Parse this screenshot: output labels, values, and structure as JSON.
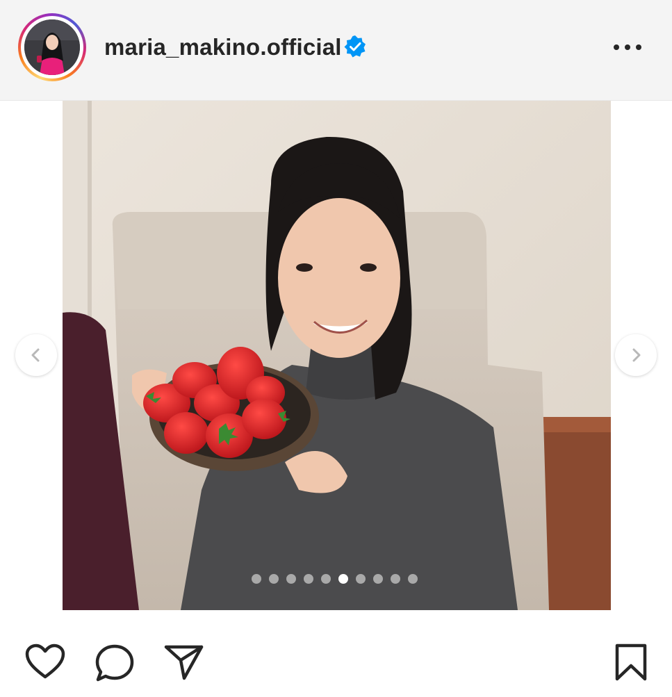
{
  "post": {
    "username": "maria_makino.official",
    "verified": true,
    "avatar_icon": "profile-photo",
    "more_icon": "more-horizontal-icon"
  },
  "carousel": {
    "total_slides": 10,
    "current_slide": 6,
    "prev_icon": "chevron-left-icon",
    "next_icon": "chevron-right-icon"
  },
  "actions": {
    "like_icon": "heart-icon",
    "comment_icon": "comment-icon",
    "share_icon": "paper-plane-icon",
    "save_icon": "bookmark-icon"
  },
  "colors": {
    "verified_blue": "#0095f6",
    "text": "#262626",
    "header_bg": "#f4f4f4"
  }
}
